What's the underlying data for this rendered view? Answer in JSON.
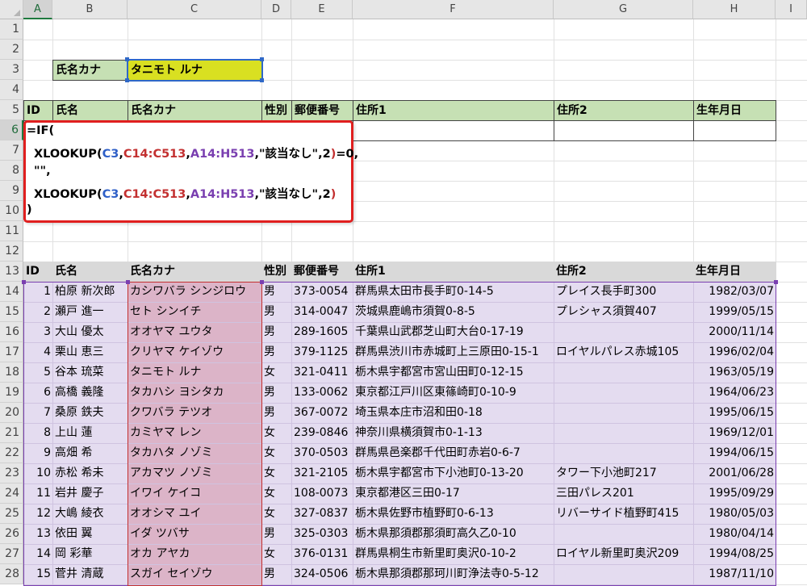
{
  "columns": [
    "A",
    "B",
    "C",
    "D",
    "E",
    "F",
    "G",
    "H",
    "I"
  ],
  "rows": [
    "1",
    "2",
    "3",
    "4",
    "5",
    "6",
    "7",
    "8",
    "9",
    "10",
    "11",
    "12",
    "13",
    "14",
    "15",
    "16",
    "17",
    "18",
    "19",
    "20",
    "21",
    "22",
    "23",
    "24",
    "25",
    "26",
    "27",
    "28"
  ],
  "search": {
    "label": "氏名カナ",
    "value": "タニモト ルナ"
  },
  "result_headers": [
    "ID",
    "氏名",
    "氏名カナ",
    "性別",
    "郵便番号",
    "住所1",
    "住所2",
    "生年月日"
  ],
  "formula": {
    "line1": "=IF(",
    "line2": {
      "fn": "XLOOKUP(",
      "a1": "C3",
      "c1": ",",
      "a2": "C14:C513",
      "c2": ",",
      "a3": "A14:H513",
      "rest": ",\"該当なし\",2",
      "close": ")",
      "tail": "=0,"
    },
    "line3": "\"\",",
    "line4": {
      "fn": "XLOOKUP(",
      "a1": "C3",
      "c1": ",",
      "a2": "C14:C513",
      "c2": ",",
      "a3": "A14:H513",
      "rest": ",\"該当なし\",2",
      "close": ")"
    },
    "line5": ")"
  },
  "table_headers": [
    "ID",
    "氏名",
    "氏名カナ",
    "性別",
    "郵便番号",
    "住所1",
    "住所2",
    "生年月日"
  ],
  "table_rows": [
    [
      "1",
      "柏原 新次郎",
      "カシワバラ シンジロウ",
      "男",
      "373-0054",
      "群馬県太田市長手町0-14-5",
      "プレイス長手町300",
      "1982/03/07"
    ],
    [
      "2",
      "瀬戸 進一",
      "セト シンイチ",
      "男",
      "314-0047",
      "茨城県鹿嶋市須賀0-8-5",
      "プレシャス須賀407",
      "1999/05/15"
    ],
    [
      "3",
      "大山 優太",
      "オオヤマ ユウタ",
      "男",
      "289-1605",
      "千葉県山武郡芝山町大台0-17-19",
      "",
      "2000/11/14"
    ],
    [
      "4",
      "栗山 恵三",
      "クリヤマ ケイゾウ",
      "男",
      "379-1125",
      "群馬県渋川市赤城町上三原田0-15-1",
      "ロイヤルパレス赤城105",
      "1996/02/04"
    ],
    [
      "5",
      "谷本 琉菜",
      "タニモト ルナ",
      "女",
      "321-0411",
      "栃木県宇都宮市宮山田町0-12-15",
      "",
      "1963/05/19"
    ],
    [
      "6",
      "高橋 義隆",
      "タカハシ ヨシタカ",
      "男",
      "133-0062",
      "東京都江戸川区東篠崎町0-10-9",
      "",
      "1964/06/23"
    ],
    [
      "7",
      "桑原 鉄夫",
      "クワバラ テツオ",
      "男",
      "367-0072",
      "埼玉県本庄市沼和田0-18",
      "",
      "1995/06/15"
    ],
    [
      "8",
      "上山 蓮",
      "カミヤマ レン",
      "女",
      "239-0846",
      "神奈川県横須賀市0-1-13",
      "",
      "1969/12/01"
    ],
    [
      "9",
      "高畑 希",
      "タカハタ ノゾミ",
      "女",
      "370-0503",
      "群馬県邑楽郡千代田町赤岩0-6-7",
      "",
      "1994/06/15"
    ],
    [
      "10",
      "赤松 希未",
      "アカマツ ノゾミ",
      "女",
      "321-2105",
      "栃木県宇都宮市下小池町0-13-20",
      "タワー下小池町217",
      "2001/06/28"
    ],
    [
      "11",
      "岩井 慶子",
      "イワイ ケイコ",
      "女",
      "108-0073",
      "東京都港区三田0-17",
      "三田パレス201",
      "1995/09/29"
    ],
    [
      "12",
      "大嶋 綾衣",
      "オオシマ ユイ",
      "女",
      "327-0837",
      "栃木県佐野市植野町0-6-13",
      "リバーサイド植野町415",
      "1980/05/03"
    ],
    [
      "13",
      "依田 翼",
      "イダ ツバサ",
      "男",
      "325-0303",
      "栃木県那須郡那須町高久乙0-10",
      "",
      "1980/04/14"
    ],
    [
      "14",
      "岡 彩華",
      "オカ アヤカ",
      "女",
      "376-0131",
      "群馬県桐生市新里町奥沢0-10-2",
      "ロイヤル新里町奥沢209",
      "1994/08/25"
    ],
    [
      "15",
      "菅井 清蔵",
      "スガイ セイゾウ",
      "男",
      "324-0506",
      "栃木県那須郡那珂川町浄法寺0-5-12",
      "",
      "1987/11/10"
    ]
  ]
}
